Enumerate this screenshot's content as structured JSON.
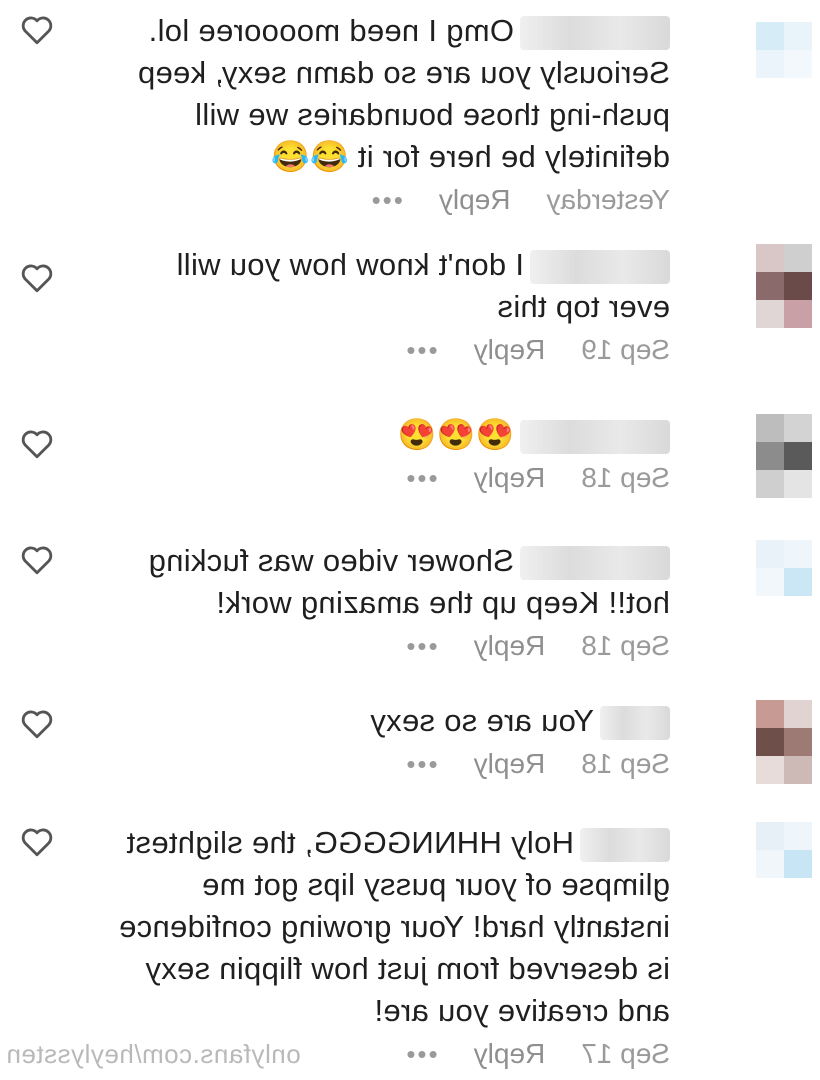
{
  "comments": [
    {
      "text": "Omg I need mooooree lol. Seriously you are so damn sexy, keep push-ing those boundaries we will definitely be here for it 😂😂",
      "time": "Yesterday",
      "reply": "Reply",
      "more": "•••"
    },
    {
      "text": "I don't know how you will ever top this",
      "time": "Sep 19",
      "reply": "Reply",
      "more": "•••"
    },
    {
      "text": "😍😍😍",
      "time": "Sep 18",
      "reply": "Reply",
      "more": "•••"
    },
    {
      "text": "Shower video was fucking hot!! Keep up the amazing work!",
      "time": "Sep 18",
      "reply": "Reply",
      "more": "•••"
    },
    {
      "text": "You are so sexy",
      "time": "Sep 18",
      "reply": "Reply",
      "more": "•••"
    },
    {
      "text": "Holy HHNNGGGG, the slightest glimpse of your pussy lips got me instantly hard! Your growing confidence is deserved from just how flippin sexy and creative you are!",
      "time": "Sep 17",
      "reply": "Reply",
      "more": "•••"
    }
  ],
  "watermark": "onlyfans.com/heylyssten",
  "icons": {
    "like": "heart-outline-icon"
  },
  "colors": {
    "text": "#1f1f1f",
    "meta": "#9a9a9a",
    "icon": "#555555"
  }
}
